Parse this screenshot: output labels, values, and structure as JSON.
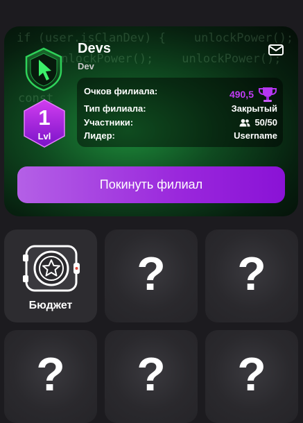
{
  "clan": {
    "name": "Devs",
    "type_tag": "Dev",
    "level_number": "1",
    "level_label": "Lvl",
    "code_lines": [
      "if (user.isClanDev) {    unlockPower();",
      "unlockPower();    unlockPower();",
      "const"
    ]
  },
  "info": {
    "points_label": "Очков филиала:",
    "points_value": "490,5",
    "type_label": "Тип филиала:",
    "type_value": "Закрытый",
    "members_label": "Участники:",
    "members_value": "50/50",
    "leader_label": "Лидер:",
    "leader_value": "Username"
  },
  "actions": {
    "leave_label": "Покинуть филиал"
  },
  "tiles": [
    {
      "label": "Бюджет",
      "icon": "vault-star-icon"
    },
    {
      "label": "?",
      "icon": "question-icon"
    },
    {
      "label": "?",
      "icon": "question-icon"
    },
    {
      "label": "?",
      "icon": "question-icon"
    },
    {
      "label": "?",
      "icon": "question-icon"
    },
    {
      "label": "?",
      "icon": "question-icon"
    }
  ],
  "colors": {
    "accent_purple": "#9a28dc",
    "points_color": "#c03cf5",
    "hero_green": "#1d8a3a",
    "tile_bg": "#2a292d"
  }
}
